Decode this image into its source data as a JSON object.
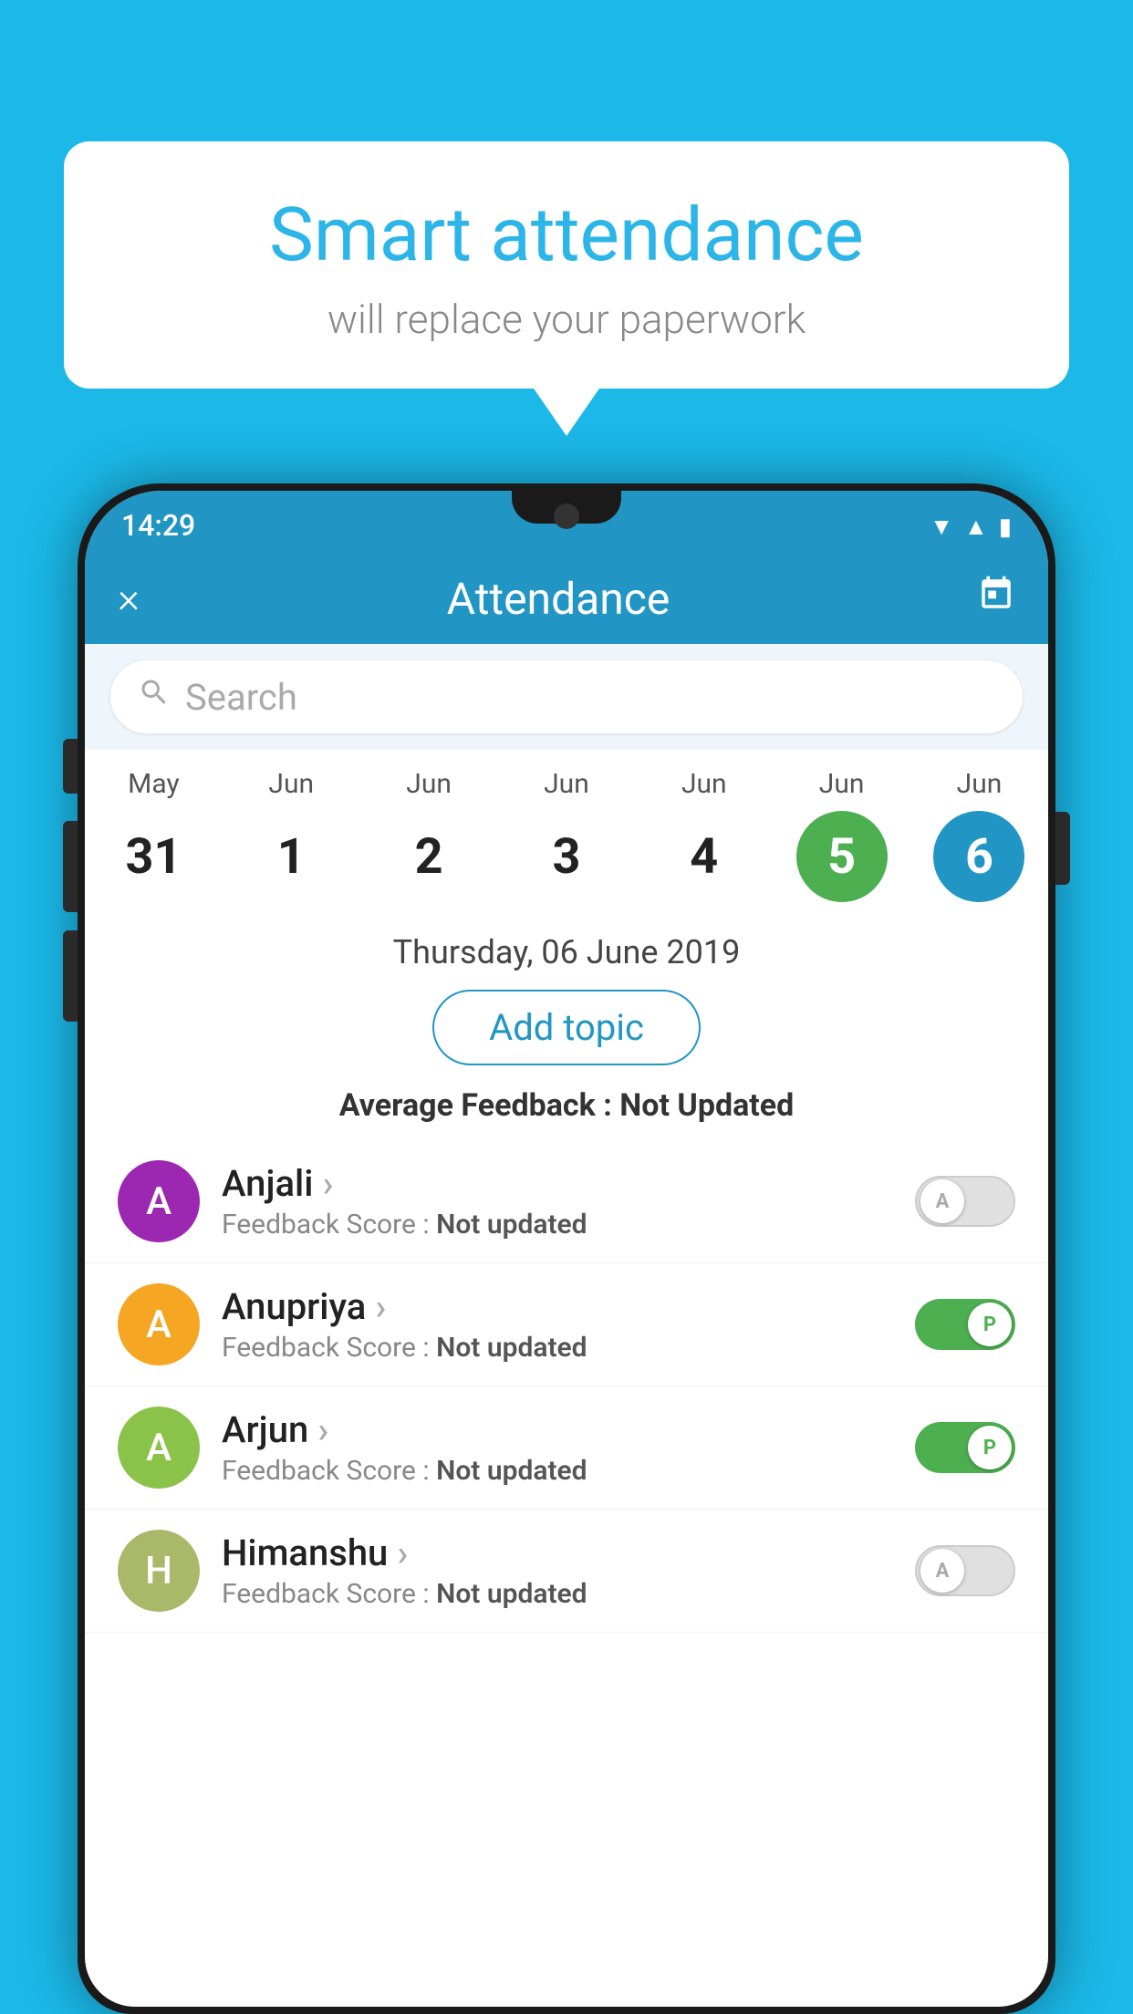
{
  "background_color": "#1bb8e8",
  "bubble": {
    "title": "Smart attendance",
    "subtitle": "will replace your paperwork"
  },
  "status_bar": {
    "time": "14:29"
  },
  "app_bar": {
    "title": "Attendance",
    "close_label": "×",
    "calendar_icon": "calendar"
  },
  "search": {
    "placeholder": "Search"
  },
  "calendar": {
    "days": [
      {
        "month": "May",
        "date": "31",
        "style": "normal"
      },
      {
        "month": "Jun",
        "date": "1",
        "style": "normal"
      },
      {
        "month": "Jun",
        "date": "2",
        "style": "normal"
      },
      {
        "month": "Jun",
        "date": "3",
        "style": "normal"
      },
      {
        "month": "Jun",
        "date": "4",
        "style": "normal"
      },
      {
        "month": "Jun",
        "date": "5",
        "style": "today"
      },
      {
        "month": "Jun",
        "date": "6",
        "style": "selected"
      }
    ]
  },
  "selected_date": "Thursday, 06 June 2019",
  "add_topic_label": "Add topic",
  "avg_feedback": {
    "label": "Average Feedback : ",
    "value": "Not Updated"
  },
  "students": [
    {
      "name": "Anjali",
      "initial": "A",
      "avatar_color": "#9c27b0",
      "feedback_label": "Feedback Score : ",
      "feedback_value": "Not updated",
      "attendance": "absent"
    },
    {
      "name": "Anupriya",
      "initial": "A",
      "avatar_color": "#f5a623",
      "feedback_label": "Feedback Score : ",
      "feedback_value": "Not updated",
      "attendance": "present"
    },
    {
      "name": "Arjun",
      "initial": "A",
      "avatar_color": "#8bc34a",
      "feedback_label": "Feedback Score : ",
      "feedback_value": "Not updated",
      "attendance": "present"
    },
    {
      "name": "Himanshu",
      "initial": "H",
      "avatar_color": "#aab86a",
      "feedback_label": "Feedback Score : ",
      "feedback_value": "Not updated",
      "attendance": "absent"
    }
  ]
}
